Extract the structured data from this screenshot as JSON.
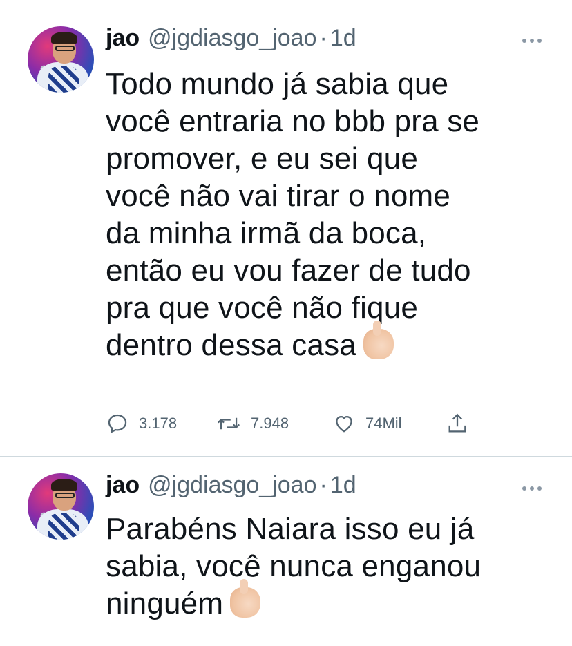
{
  "tweets": [
    {
      "name": "jao",
      "handle": "@jgdiasgo_joao",
      "separator": "·",
      "time": "1d",
      "lines": [
        "Todo mundo já sabia que",
        "você entraria no bbb pra se",
        "promover, e eu sei que",
        "você não vai tirar o nome",
        "da minha irmã da boca,",
        "então eu vou fazer de tudo",
        "pra que você não fique",
        "dentro dessa casa"
      ],
      "emoji": "thumbs-up-emoji",
      "stats": {
        "replies": "3.178",
        "retweets": "7.948",
        "likes": "74Mil"
      }
    },
    {
      "name": "jao",
      "handle": "@jgdiasgo_joao",
      "separator": "·",
      "time": "1d",
      "lines": [
        "Parabéns Naiara isso eu já",
        "sabia, você nunca enganou",
        "ninguém"
      ],
      "emoji": "thumbs-up-emoji"
    }
  ],
  "icons": {
    "reply": "reply-icon",
    "retweet": "retweet-icon",
    "like": "like-icon",
    "share": "share-icon",
    "more": "more-icon"
  },
  "colors": {
    "text": "#0f1419",
    "secondary": "#536471",
    "divider": "#cfd9de"
  }
}
